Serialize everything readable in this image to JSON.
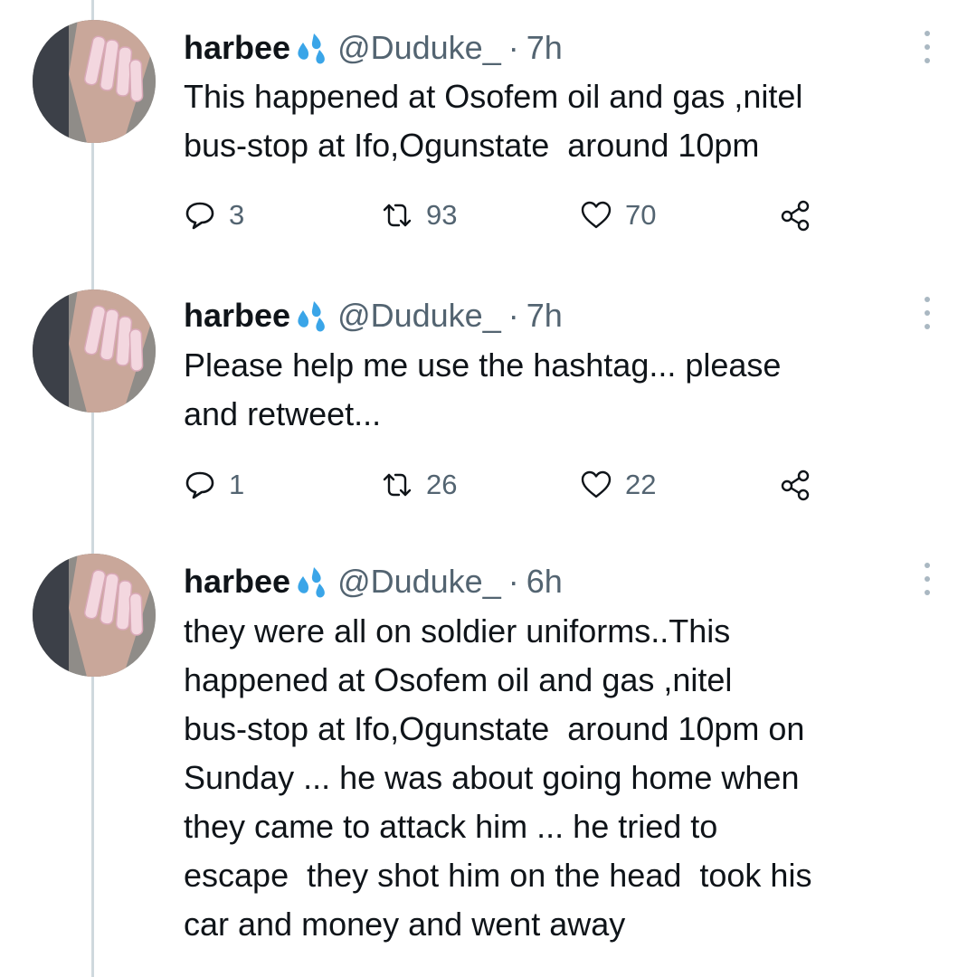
{
  "colors": {
    "text": "#0f1419",
    "secondary": "#536471",
    "thread_line": "#cfd9de",
    "emoji_blue": "#3aa5e8"
  },
  "tweets": [
    {
      "name": "harbee",
      "handle": "@Duduke_",
      "separator": "·",
      "time": "7h",
      "text": "This happened at Osofem oil and gas ,nitel\nbus-stop at Ifo,Ogunstate  around 10pm",
      "replies": "3",
      "retweets": "93",
      "likes": "70"
    },
    {
      "name": "harbee",
      "handle": "@Duduke_",
      "separator": "·",
      "time": "7h",
      "text": "Please help me use the hashtag... please\nand retweet...",
      "replies": "1",
      "retweets": "26",
      "likes": "22"
    },
    {
      "name": "harbee",
      "handle": "@Duduke_",
      "separator": "·",
      "time": "6h",
      "text": "they were all on soldier uniforms..This\nhappened at Osofem oil and gas ,nitel\nbus-stop at Ifo,Ogunstate  around 10pm on\nSunday ... he was about going home when\nthey came to attack him ... he tried to\nescape  they shot him on the head  took his\ncar and money and went away"
    }
  ],
  "icons": {
    "reply": "reply-icon",
    "retweet": "retweet-icon",
    "like": "heart-icon",
    "share": "share-icon",
    "more": "more-options-icon",
    "emoji": "sweat-droplets-emoji"
  }
}
